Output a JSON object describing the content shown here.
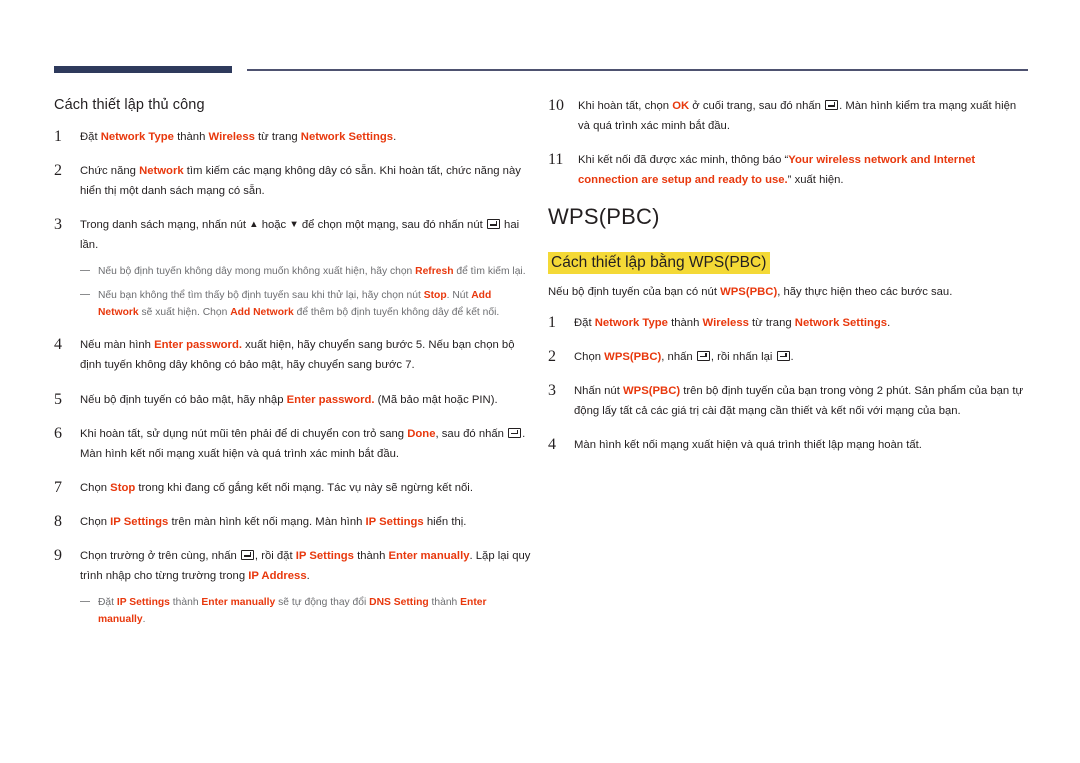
{
  "colors": {
    "rule_thick": "#2e3a5c",
    "rule_thin": "#4e5270",
    "keyword": "#e8380d",
    "highlight": "#f4d936",
    "note_text": "#6d6e71",
    "body_text": "#231f20"
  },
  "left_column": {
    "heading": "Cách thiết lập thủ công",
    "steps": [
      {
        "num": "1",
        "parts": [
          {
            "t": "Đặt ",
            "k": false
          },
          {
            "t": "Network Type",
            "k": true
          },
          {
            "t": " thành ",
            "k": false
          },
          {
            "t": "Wireless",
            "k": true
          },
          {
            "t": " từ trang ",
            "k": false
          },
          {
            "t": "Network Settings",
            "k": true
          },
          {
            "t": ".",
            "k": false
          }
        ]
      },
      {
        "num": "2",
        "parts": [
          {
            "t": "Chức năng ",
            "k": false
          },
          {
            "t": "Network",
            "k": true
          },
          {
            "t": " tìm kiếm các mạng không dây có sẵn. Khi hoàn tất, chức năng này hiển thị một danh sách mạng có sẵn.",
            "k": false
          }
        ]
      },
      {
        "num": "3",
        "parts": [
          {
            "t": "Trong danh sách mạng, nhấn nút ",
            "k": false
          },
          {
            "t": "▲",
            "k": false,
            "glyph": true
          },
          {
            "t": " hoặc ",
            "k": false
          },
          {
            "t": "▼",
            "k": false,
            "glyph": true
          },
          {
            "t": " để chọn một mạng, sau đó nhấn nút ",
            "k": false
          },
          {
            "t": "",
            "k": false,
            "enter": true
          },
          {
            "t": " hai lần.",
            "k": false
          }
        ],
        "notes": [
          [
            {
              "t": "Nếu bộ định tuyến không dây mong muốn không xuất hiện, hãy chọn ",
              "k": false
            },
            {
              "t": "Refresh",
              "k": true
            },
            {
              "t": " để tìm kiếm lại.",
              "k": false
            }
          ],
          [
            {
              "t": "Nếu bạn không thể tìm thấy bộ định tuyến sau khi thử lại, hãy chọn nút ",
              "k": false
            },
            {
              "t": "Stop",
              "k": true
            },
            {
              "t": ". Nút ",
              "k": false
            },
            {
              "t": "Add Network",
              "k": true
            },
            {
              "t": " sẽ xuất hiện. Chọn ",
              "k": false
            },
            {
              "t": "Add Network",
              "k": true
            },
            {
              "t": " để thêm bộ định tuyến không dây để kết nối.",
              "k": false
            }
          ]
        ]
      },
      {
        "num": "4",
        "parts": [
          {
            "t": "Nếu màn hình ",
            "k": false
          },
          {
            "t": "Enter password.",
            "k": true
          },
          {
            "t": " xuất hiện, hãy chuyển sang bước 5. Nếu bạn chọn bộ định tuyến không dây không có bảo mật, hãy chuyển sang bước 7.",
            "k": false
          }
        ]
      },
      {
        "num": "5",
        "parts": [
          {
            "t": "Nếu bộ định tuyến có bảo mật, hãy nhập ",
            "k": false
          },
          {
            "t": "Enter password.",
            "k": true
          },
          {
            "t": " (Mã bảo mật hoặc PIN).",
            "k": false
          }
        ]
      },
      {
        "num": "6",
        "parts": [
          {
            "t": "Khi hoàn tất, sử dụng nút mũi tên phải để di chuyển con trỏ sang ",
            "k": false
          },
          {
            "t": "Done",
            "k": true
          },
          {
            "t": ", sau đó nhấn ",
            "k": false
          },
          {
            "t": "",
            "k": false,
            "enter": true
          },
          {
            "t": ". Màn hình kết nối mạng xuất hiện và quá trình xác minh bắt đầu.",
            "k": false
          }
        ]
      },
      {
        "num": "7",
        "parts": [
          {
            "t": "Chọn ",
            "k": false
          },
          {
            "t": "Stop",
            "k": true
          },
          {
            "t": " trong khi đang cố gắng kết nối mạng. Tác vụ này sẽ ngừng kết nối.",
            "k": false
          }
        ]
      },
      {
        "num": "8",
        "parts": [
          {
            "t": "Chọn ",
            "k": false
          },
          {
            "t": "IP Settings",
            "k": true
          },
          {
            "t": " trên màn hình kết nối mạng. Màn hình ",
            "k": false
          },
          {
            "t": "IP Settings",
            "k": true
          },
          {
            "t": " hiển thị.",
            "k": false
          }
        ]
      },
      {
        "num": "9",
        "parts": [
          {
            "t": "Chọn trường ở trên cùng, nhấn ",
            "k": false
          },
          {
            "t": "",
            "k": false,
            "enter": true
          },
          {
            "t": ", rồi đặt ",
            "k": false
          },
          {
            "t": "IP Settings",
            "k": true
          },
          {
            "t": " thành ",
            "k": false
          },
          {
            "t": "Enter manually",
            "k": true
          },
          {
            "t": ". Lặp lại quy trình nhập cho từng trường trong ",
            "k": false
          },
          {
            "t": "IP Address",
            "k": true
          },
          {
            "t": ".",
            "k": false
          }
        ],
        "notes": [
          [
            {
              "t": "Đặt ",
              "k": false
            },
            {
              "t": "IP Settings",
              "k": true
            },
            {
              "t": " thành ",
              "k": false
            },
            {
              "t": "Enter manually",
              "k": true
            },
            {
              "t": " sẽ tự động thay đổi ",
              "k": false
            },
            {
              "t": "DNS Setting",
              "k": true
            },
            {
              "t": " thành ",
              "k": false
            },
            {
              "t": "Enter manually",
              "k": true
            },
            {
              "t": ".",
              "k": false
            }
          ]
        ]
      }
    ]
  },
  "right_column": {
    "continued_steps": [
      {
        "num": "10",
        "parts": [
          {
            "t": "Khi hoàn tất, chọn ",
            "k": false
          },
          {
            "t": "OK",
            "k": true
          },
          {
            "t": " ở cuối trang, sau đó nhấn ",
            "k": false
          },
          {
            "t": "",
            "k": false,
            "enter": true
          },
          {
            "t": ". Màn hình kiểm tra mạng xuất hiện và quá trình xác minh bắt đầu.",
            "k": false
          }
        ]
      },
      {
        "num": "11",
        "parts": [
          {
            "t": "Khi kết nối đã được xác minh, thông báo “",
            "k": false
          },
          {
            "t": "Your wireless network and Internet connection are setup and ready to use.",
            "k": true
          },
          {
            "t": "” xuất hiện.",
            "k": false
          }
        ]
      }
    ],
    "title": "WPS(PBC)",
    "highlight_heading": "Cách thiết lập bằng WPS(PBC)",
    "lead": [
      {
        "t": "Nếu bộ định tuyến của bạn có nút ",
        "k": false
      },
      {
        "t": "WPS(PBC)",
        "k": true
      },
      {
        "t": ", hãy thực hiện theo các bước sau.",
        "k": false
      }
    ],
    "steps": [
      {
        "num": "1",
        "parts": [
          {
            "t": "Đặt ",
            "k": false
          },
          {
            "t": "Network Type",
            "k": true
          },
          {
            "t": " thành ",
            "k": false
          },
          {
            "t": "Wireless",
            "k": true
          },
          {
            "t": " từ trang ",
            "k": false
          },
          {
            "t": "Network Settings",
            "k": true
          },
          {
            "t": ".",
            "k": false
          }
        ]
      },
      {
        "num": "2",
        "parts": [
          {
            "t": "Chọn ",
            "k": false
          },
          {
            "t": "WPS(PBC)",
            "k": true
          },
          {
            "t": ", nhấn ",
            "k": false
          },
          {
            "t": "",
            "k": false,
            "enter": true
          },
          {
            "t": ", rồi nhấn lại ",
            "k": false
          },
          {
            "t": "",
            "k": false,
            "enter": true
          },
          {
            "t": ".",
            "k": false
          }
        ]
      },
      {
        "num": "3",
        "parts": [
          {
            "t": "Nhấn nút ",
            "k": false
          },
          {
            "t": "WPS(PBC)",
            "k": true
          },
          {
            "t": " trên bộ định tuyến của bạn trong vòng 2 phút. Sản phẩm của bạn tự động lấy tất cả các giá trị cài đặt mạng cần thiết và kết nối với mạng của bạn.",
            "k": false
          }
        ]
      },
      {
        "num": "4",
        "parts": [
          {
            "t": "Màn hình kết nối mạng xuất hiện và quá trình thiết lập mạng hoàn tất.",
            "k": false
          }
        ]
      }
    ]
  }
}
